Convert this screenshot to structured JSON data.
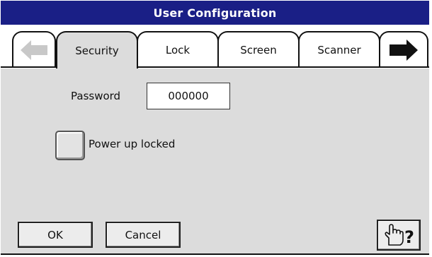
{
  "window": {
    "title": "User Configuration"
  },
  "tabs": [
    {
      "label": "",
      "icon": "left-arrow-icon",
      "enabled": false
    },
    {
      "label": "Security",
      "active": true
    },
    {
      "label": "Lock"
    },
    {
      "label": "Screen"
    },
    {
      "label": "Scanner"
    },
    {
      "label": "",
      "icon": "right-arrow-icon",
      "enabled": true
    }
  ],
  "security": {
    "password_label": "Password",
    "password_value": "000000",
    "power_up_locked_label": "Power up locked",
    "power_up_locked_checked": false
  },
  "buttons": {
    "ok_label": "OK",
    "cancel_label": "Cancel",
    "help_icon": "pointing-hand-question-icon"
  },
  "colors": {
    "title_bar": "#1a1f86",
    "panel_bg": "#dcdcdc"
  }
}
